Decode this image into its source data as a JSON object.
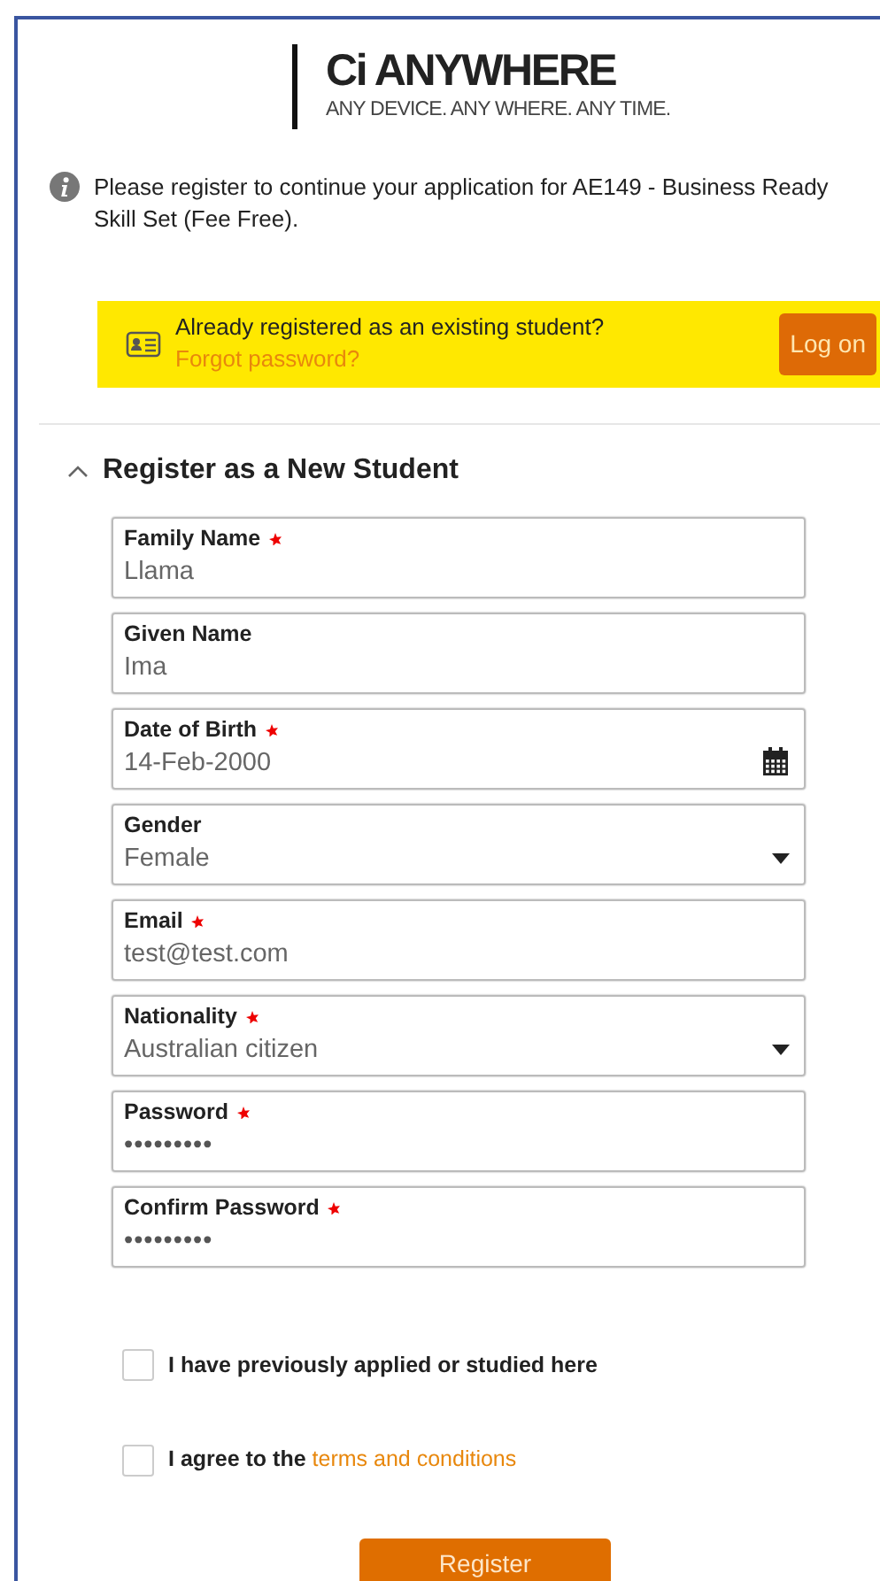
{
  "logo": {
    "title": "Ci ANYWHERE",
    "tagline": "ANY DEVICE. ANY WHERE. ANY TIME."
  },
  "notice": "Please register to continue your application for AE149 - Business Ready Skill Set (Fee Free).",
  "login_banner": {
    "question": "Already registered as an existing student?",
    "forgot_link": "Forgot password?",
    "button": "Log on"
  },
  "section": {
    "title": "Register as a New Student",
    "expanded": true
  },
  "fields": [
    {
      "kind": "text",
      "label": "Family Name",
      "required": true,
      "value": "Llama"
    },
    {
      "kind": "text",
      "label": "Given Name",
      "required": false,
      "value": "Ima"
    },
    {
      "kind": "date",
      "label": "Date of Birth",
      "required": true,
      "value": "14-Feb-2000"
    },
    {
      "kind": "select",
      "label": "Gender",
      "required": false,
      "value": "Female"
    },
    {
      "kind": "text",
      "label": "Email",
      "required": true,
      "value": "test@test.com"
    },
    {
      "kind": "select",
      "label": "Nationality",
      "required": true,
      "value": "Australian citizen"
    },
    {
      "kind": "password",
      "label": "Password",
      "required": true,
      "value": "•••••••••"
    },
    {
      "kind": "password",
      "label": "Confirm Password",
      "required": true,
      "value": "•••••••••"
    }
  ],
  "checkboxes": [
    {
      "label": "I have previously applied or studied here",
      "checked": false
    },
    {
      "label": "I agree to the",
      "link": "terms and conditions",
      "checked": false
    }
  ],
  "register_button": "Register"
}
